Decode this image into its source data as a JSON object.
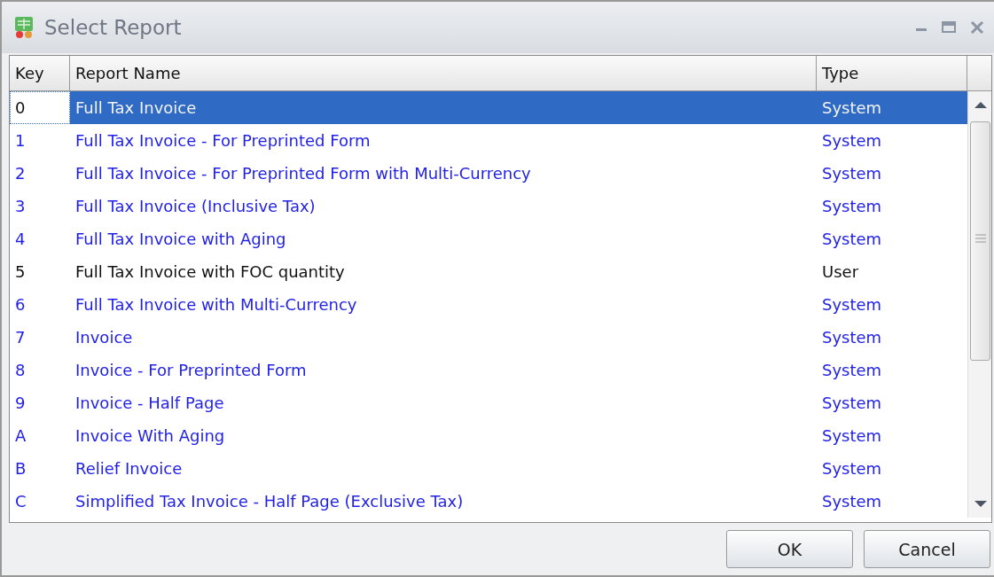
{
  "window": {
    "title": "Select Report"
  },
  "table": {
    "columns": [
      "Key",
      "Report Name",
      "Type"
    ],
    "rows": [
      {
        "key": "0",
        "name": "Full Tax Invoice",
        "type": "System",
        "kind": "system",
        "selected": true
      },
      {
        "key": "1",
        "name": "Full Tax Invoice - For Preprinted Form",
        "type": "System",
        "kind": "system",
        "selected": false
      },
      {
        "key": "2",
        "name": "Full Tax Invoice - For Preprinted Form with Multi-Currency",
        "type": "System",
        "kind": "system",
        "selected": false
      },
      {
        "key": "3",
        "name": "Full Tax Invoice (Inclusive Tax)",
        "type": "System",
        "kind": "system",
        "selected": false
      },
      {
        "key": "4",
        "name": "Full Tax Invoice with Aging",
        "type": "System",
        "kind": "system",
        "selected": false
      },
      {
        "key": "5",
        "name": "Full Tax Invoice with FOC quantity",
        "type": "User",
        "kind": "user",
        "selected": false
      },
      {
        "key": "6",
        "name": "Full Tax Invoice with Multi-Currency",
        "type": "System",
        "kind": "system",
        "selected": false
      },
      {
        "key": "7",
        "name": "Invoice",
        "type": "System",
        "kind": "system",
        "selected": false
      },
      {
        "key": "8",
        "name": "Invoice - For Preprinted Form",
        "type": "System",
        "kind": "system",
        "selected": false
      },
      {
        "key": "9",
        "name": "Invoice - Half Page",
        "type": "System",
        "kind": "system",
        "selected": false
      },
      {
        "key": "A",
        "name": "Invoice With Aging",
        "type": "System",
        "kind": "system",
        "selected": false
      },
      {
        "key": "B",
        "name": "Relief Invoice",
        "type": "System",
        "kind": "system",
        "selected": false
      },
      {
        "key": "C",
        "name": "Simplified Tax Invoice - Half Page (Exclusive Tax)",
        "type": "System",
        "kind": "system",
        "selected": false
      }
    ]
  },
  "buttons": [
    "OK",
    "Cancel"
  ]
}
